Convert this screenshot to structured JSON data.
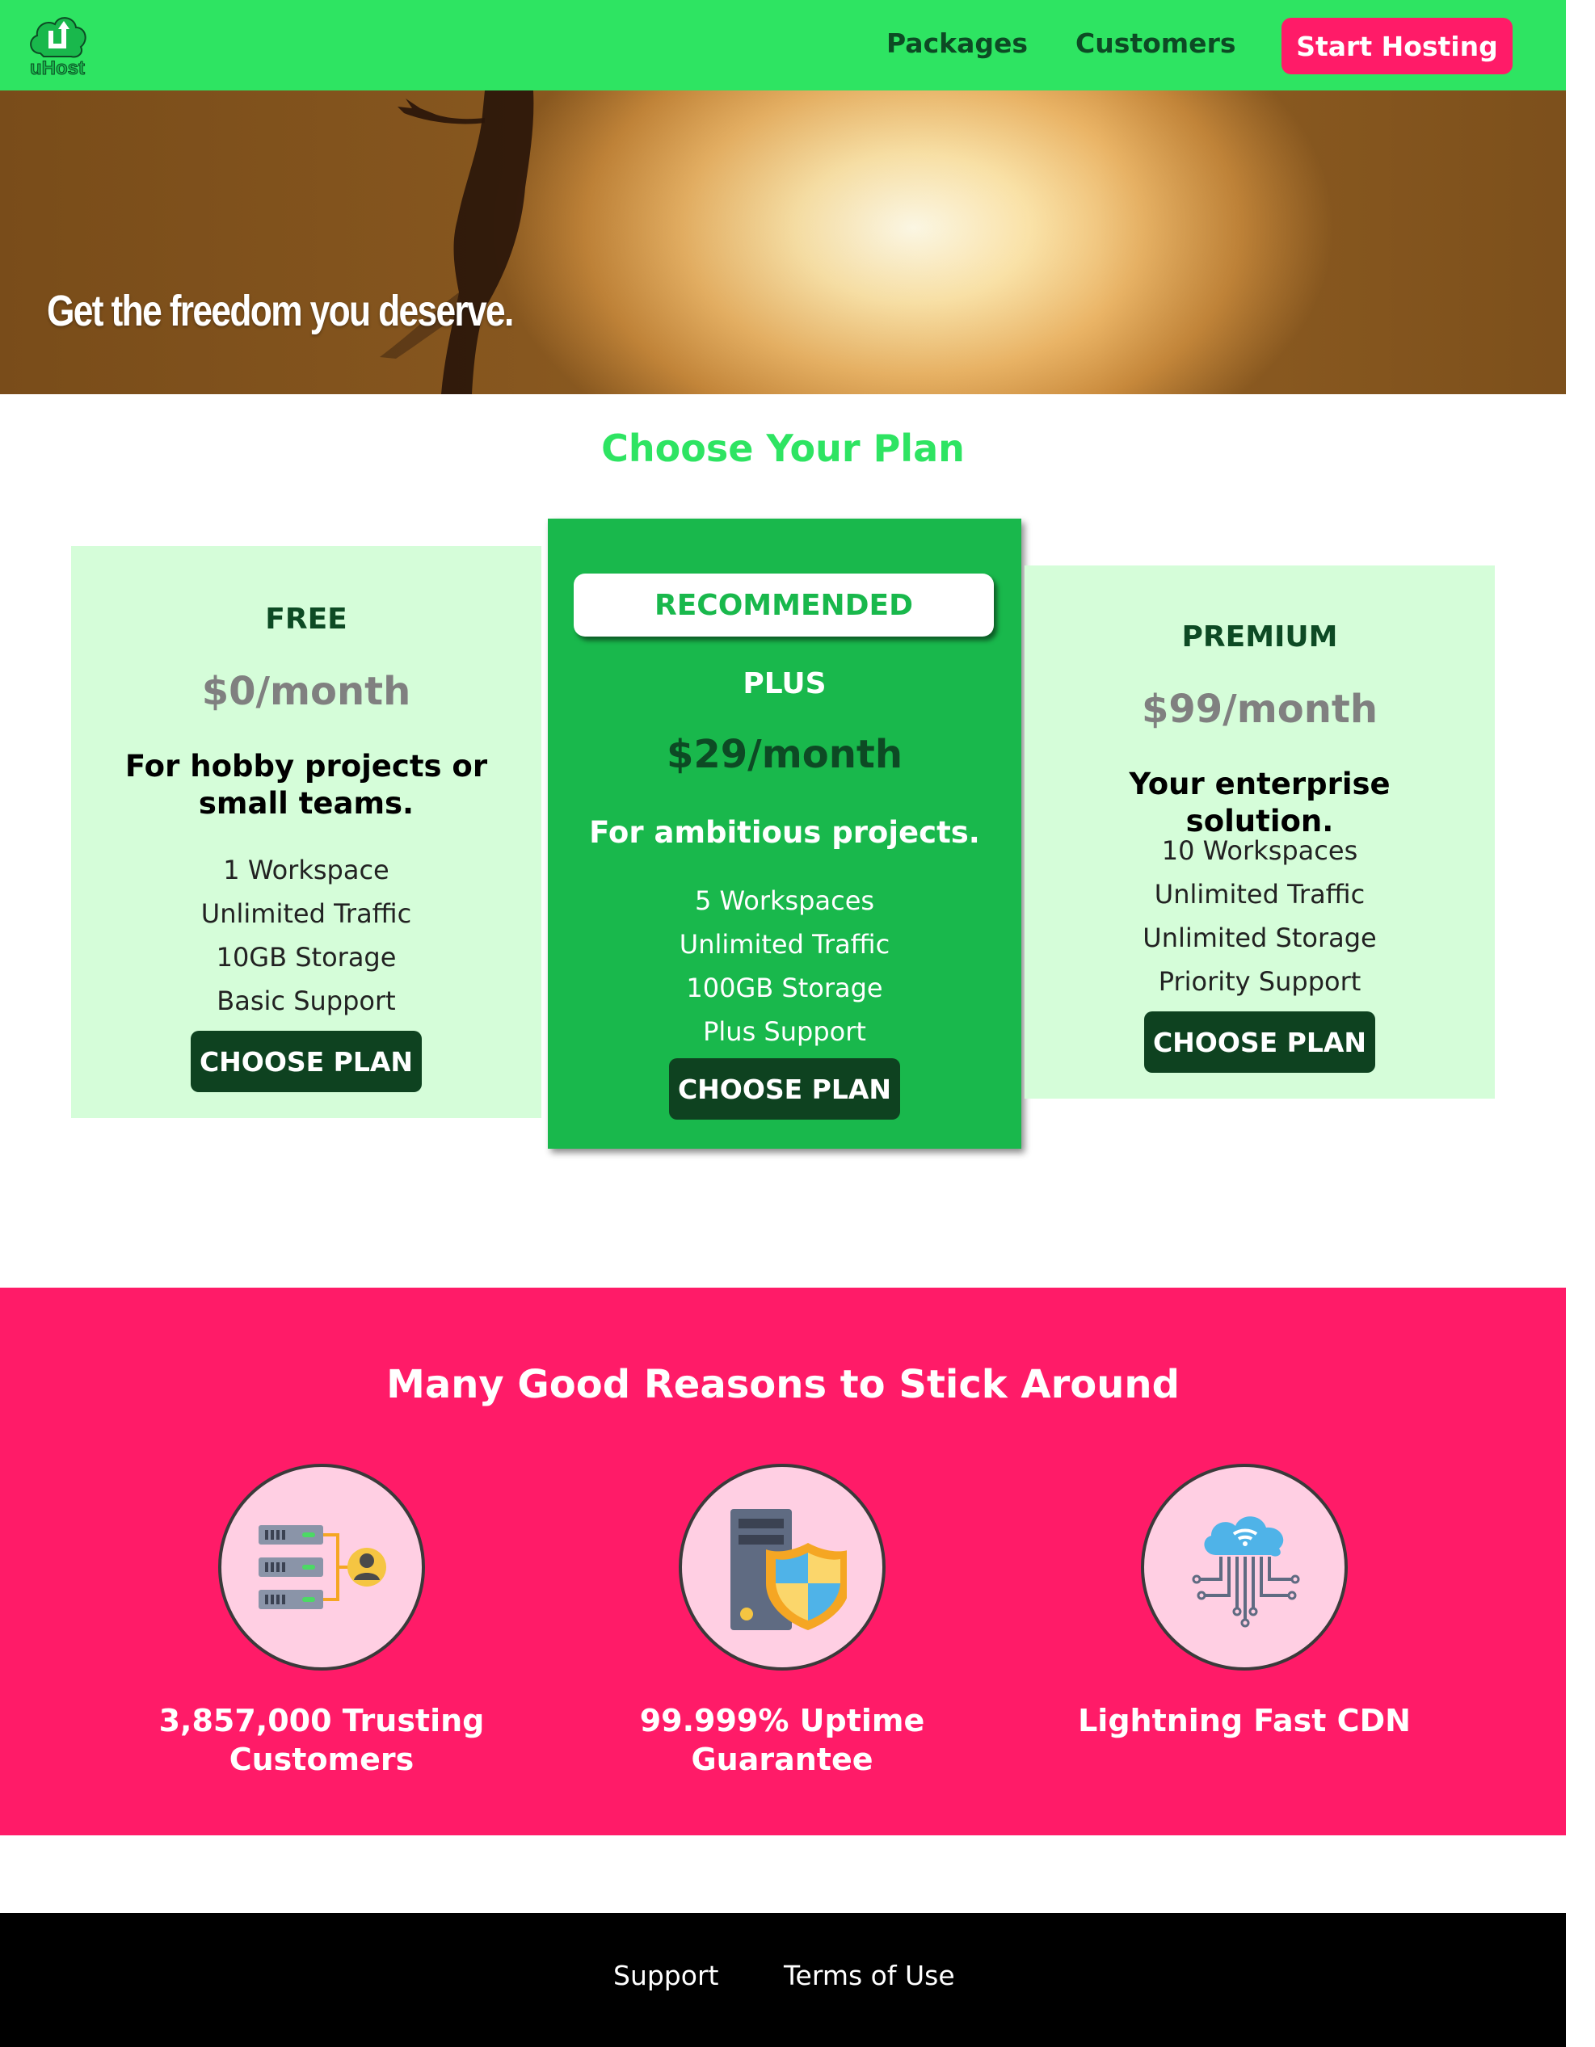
{
  "brand": {
    "name": "uHost",
    "color_primary": "#2ee462",
    "color_accent": "#ff1b68",
    "color_dark": "#0e4220"
  },
  "nav": {
    "links": [
      {
        "label": "Packages"
      },
      {
        "label": "Customers"
      }
    ],
    "cta_label": "Start Hosting"
  },
  "hero": {
    "title": "Get the freedom you deserve."
  },
  "plans": {
    "title": "Choose Your Plan",
    "items": [
      {
        "name": "FREE",
        "price": "$0/month",
        "description": "For hobby projects or small teams.",
        "features": [
          "1 Workspace",
          "Unlimited Traffic",
          "10GB Storage",
          "Basic Support"
        ],
        "button": "CHOOSE PLAN"
      },
      {
        "badge": "RECOMMENDED",
        "name": "PLUS",
        "price": "$29/month",
        "description": "For ambitious projects.",
        "features": [
          "5 Workspaces",
          "Unlimited Traffic",
          "100GB Storage",
          "Plus Support"
        ],
        "button": "CHOOSE PLAN"
      },
      {
        "name": "PREMIUM",
        "price": "$99/month",
        "description": "Your enterprise solution.",
        "features": [
          "10 Workspaces",
          "Unlimited Traffic",
          "Unlimited Storage",
          "Priority Support"
        ],
        "button": "CHOOSE PLAN"
      }
    ]
  },
  "reasons": {
    "title": "Many Good Reasons to Stick Around",
    "items": [
      {
        "icon": "server-customer-icon",
        "text": "3,857,000 Trusting Customers"
      },
      {
        "icon": "server-shield-icon",
        "text": "99.999% Uptime Guarantee"
      },
      {
        "icon": "cloud-cdn-icon",
        "text": "Lightning Fast CDN"
      }
    ]
  },
  "footer": {
    "links": [
      {
        "label": "Support"
      },
      {
        "label": "Terms of Use"
      }
    ]
  }
}
